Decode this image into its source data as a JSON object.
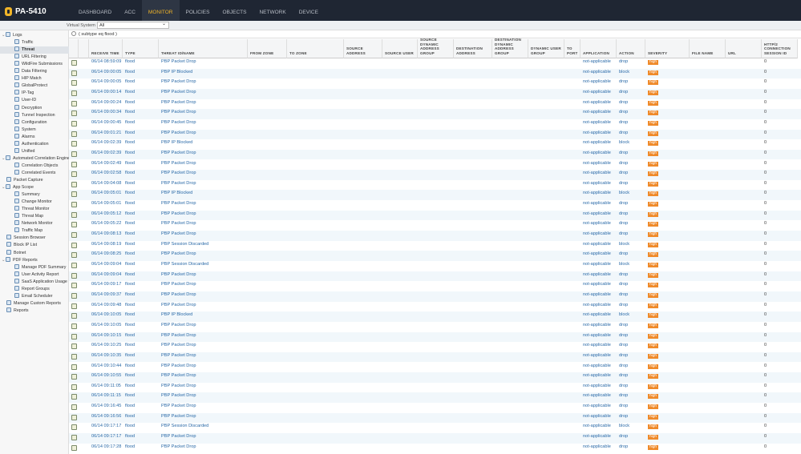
{
  "app": {
    "title": "PA-5410"
  },
  "nav": {
    "tabs": [
      {
        "label": "DASHBOARD"
      },
      {
        "label": "ACC"
      },
      {
        "label": "MONITOR",
        "active": true
      },
      {
        "label": "POLICIES"
      },
      {
        "label": "OBJECTS"
      },
      {
        "label": "NETWORK"
      },
      {
        "label": "DEVICE"
      }
    ]
  },
  "vsys": {
    "label": "Virtual System",
    "value": "All"
  },
  "search": {
    "query": "( subtype eq flood )"
  },
  "sidebar": [
    {
      "label": "Logs",
      "level": 0,
      "expander": true,
      "icon": "logs-icon"
    },
    {
      "label": "Traffic",
      "level": 1,
      "icon": "traffic-icon"
    },
    {
      "label": "Threat",
      "level": 1,
      "icon": "threat-icon",
      "active": true
    },
    {
      "label": "URL Filtering",
      "level": 1,
      "icon": "url-filtering-icon"
    },
    {
      "label": "WildFire Submissions",
      "level": 1,
      "icon": "wildfire-icon"
    },
    {
      "label": "Data Filtering",
      "level": 1,
      "icon": "data-filtering-icon"
    },
    {
      "label": "HIP Match",
      "level": 1,
      "icon": "hip-match-icon"
    },
    {
      "label": "GlobalProtect",
      "level": 1,
      "icon": "globalprotect-icon"
    },
    {
      "label": "IP-Tag",
      "level": 1,
      "icon": "ip-tag-icon"
    },
    {
      "label": "User-ID",
      "level": 1,
      "icon": "user-id-icon"
    },
    {
      "label": "Decryption",
      "level": 1,
      "icon": "decryption-icon"
    },
    {
      "label": "Tunnel Inspection",
      "level": 1,
      "icon": "tunnel-icon"
    },
    {
      "label": "Configuration",
      "level": 1,
      "icon": "configuration-icon"
    },
    {
      "label": "System",
      "level": 1,
      "icon": "system-icon"
    },
    {
      "label": "Alarms",
      "level": 1,
      "icon": "alarms-icon"
    },
    {
      "label": "Authentication",
      "level": 1,
      "icon": "authentication-icon"
    },
    {
      "label": "Unified",
      "level": 1,
      "icon": "unified-icon"
    },
    {
      "label": "Automated Correlation Engine",
      "level": 0,
      "expander": true,
      "icon": "correlation-engine-icon"
    },
    {
      "label": "Correlation Objects",
      "level": 1,
      "icon": "correlation-objects-icon"
    },
    {
      "label": "Correlated Events",
      "level": 1,
      "icon": "correlated-events-icon"
    },
    {
      "label": "Packet Capture",
      "level": 0,
      "icon": "packet-capture-icon"
    },
    {
      "label": "App Scope",
      "level": 0,
      "expander": true,
      "icon": "app-scope-icon"
    },
    {
      "label": "Summary",
      "level": 1,
      "icon": "summary-icon"
    },
    {
      "label": "Change Monitor",
      "level": 1,
      "icon": "change-monitor-icon"
    },
    {
      "label": "Threat Monitor",
      "level": 1,
      "icon": "threat-monitor-icon"
    },
    {
      "label": "Threat Map",
      "level": 1,
      "icon": "threat-map-icon"
    },
    {
      "label": "Network Monitor",
      "level": 1,
      "icon": "network-monitor-icon"
    },
    {
      "label": "Traffic Map",
      "level": 1,
      "icon": "traffic-map-icon"
    },
    {
      "label": "Session Browser",
      "level": 0,
      "icon": "session-browser-icon"
    },
    {
      "label": "Block IP List",
      "level": 0,
      "icon": "block-ip-icon"
    },
    {
      "label": "Botnet",
      "level": 0,
      "icon": "botnet-icon"
    },
    {
      "label": "PDF Reports",
      "level": 0,
      "expander": true,
      "icon": "pdf-reports-icon"
    },
    {
      "label": "Manage PDF Summary",
      "level": 1,
      "icon": "pdf-summary-icon"
    },
    {
      "label": "User Activity Report",
      "level": 1,
      "icon": "user-activity-icon"
    },
    {
      "label": "SaaS Application Usage",
      "level": 1,
      "icon": "saas-icon"
    },
    {
      "label": "Report Groups",
      "level": 1,
      "icon": "report-groups-icon"
    },
    {
      "label": "Email Scheduler",
      "level": 1,
      "icon": "email-scheduler-icon"
    },
    {
      "label": "Manage Custom Reports",
      "level": 0,
      "icon": "custom-reports-icon"
    },
    {
      "label": "Reports",
      "level": 0,
      "icon": "reports-icon"
    }
  ],
  "columns": [
    {
      "key": "receive_time",
      "label": "RECEIVE TIME"
    },
    {
      "key": "type",
      "label": "TYPE"
    },
    {
      "key": "threat",
      "label": "THREAT ID/NAME"
    },
    {
      "key": "from_zone",
      "label": "FROM ZONE"
    },
    {
      "key": "to_zone",
      "label": "TO ZONE"
    },
    {
      "key": "src_addr",
      "label": "SOURCE ADDRESS"
    },
    {
      "key": "src_user",
      "label": "SOURCE USER"
    },
    {
      "key": "src_dag",
      "label": "SOURCE DYNAMIC ADDRESS GROUP"
    },
    {
      "key": "dst_addr",
      "label": "DESTINATION ADDRESS"
    },
    {
      "key": "dst_dag",
      "label": "DESTINATION DYNAMIC ADDRESS GROUP"
    },
    {
      "key": "dug",
      "label": "DYNAMIC USER GROUP"
    },
    {
      "key": "to_port",
      "label": "TO PORT"
    },
    {
      "key": "application",
      "label": "APPLICATION"
    },
    {
      "key": "action",
      "label": "ACTION"
    },
    {
      "key": "severity",
      "label": "SEVERITY"
    },
    {
      "key": "file_name",
      "label": "FILE NAME"
    },
    {
      "key": "url",
      "label": "URL"
    },
    {
      "key": "http2",
      "label": "HTTP/2 CONNECTION SESSION ID"
    }
  ],
  "rows": [
    [
      "06/14 08:59:09",
      "PBP Packet Drop",
      "drop"
    ],
    [
      "06/14 09:00:05",
      "PBP IP Blocked",
      "block"
    ],
    [
      "06/14 09:00:05",
      "PBP Packet Drop",
      "drop"
    ],
    [
      "06/14 09:00:14",
      "PBP Packet Drop",
      "drop"
    ],
    [
      "06/14 09:00:24",
      "PBP Packet Drop",
      "drop"
    ],
    [
      "06/14 09:00:34",
      "PBP Packet Drop",
      "drop"
    ],
    [
      "06/14 09:00:45",
      "PBP Packet Drop",
      "drop"
    ],
    [
      "06/14 09:01:21",
      "PBP Packet Drop",
      "drop"
    ],
    [
      "06/14 09:02:39",
      "PBP IP Blocked",
      "block"
    ],
    [
      "06/14 09:02:39",
      "PBP Packet Drop",
      "drop"
    ],
    [
      "06/14 09:02:49",
      "PBP Packet Drop",
      "drop"
    ],
    [
      "06/14 09:02:58",
      "PBP Packet Drop",
      "drop"
    ],
    [
      "06/14 09:04:08",
      "PBP Packet Drop",
      "drop"
    ],
    [
      "06/14 09:05:01",
      "PBP IP Blocked",
      "block"
    ],
    [
      "06/14 09:05:01",
      "PBP Packet Drop",
      "drop"
    ],
    [
      "06/14 09:05:12",
      "PBP Packet Drop",
      "drop"
    ],
    [
      "06/14 09:05:22",
      "PBP Packet Drop",
      "drop"
    ],
    [
      "06/14 09:08:13",
      "PBP Packet Drop",
      "drop"
    ],
    [
      "06/14 09:08:19",
      "PBP Session Discarded",
      "block"
    ],
    [
      "06/14 09:08:25",
      "PBP Packet Drop",
      "drop"
    ],
    [
      "06/14 09:09:04",
      "PBP Session Discarded",
      "block"
    ],
    [
      "06/14 09:09:04",
      "PBP Packet Drop",
      "drop"
    ],
    [
      "06/14 09:09:17",
      "PBP Packet Drop",
      "drop"
    ],
    [
      "06/14 09:09:37",
      "PBP Packet Drop",
      "drop"
    ],
    [
      "06/14 09:09:48",
      "PBP Packet Drop",
      "drop"
    ],
    [
      "06/14 09:10:05",
      "PBP IP Blocked",
      "block"
    ],
    [
      "06/14 09:10:05",
      "PBP Packet Drop",
      "drop"
    ],
    [
      "06/14 09:10:15",
      "PBP Packet Drop",
      "drop"
    ],
    [
      "06/14 09:10:25",
      "PBP Packet Drop",
      "drop"
    ],
    [
      "06/14 09:10:35",
      "PBP Packet Drop",
      "drop"
    ],
    [
      "06/14 09:10:44",
      "PBP Packet Drop",
      "drop"
    ],
    [
      "06/14 09:10:55",
      "PBP Packet Drop",
      "drop"
    ],
    [
      "06/14 09:11:05",
      "PBP Packet Drop",
      "drop"
    ],
    [
      "06/14 09:11:15",
      "PBP Packet Drop",
      "drop"
    ],
    [
      "06/14 09:16:45",
      "PBP Packet Drop",
      "drop"
    ],
    [
      "06/14 09:16:56",
      "PBP Packet Drop",
      "drop"
    ],
    [
      "06/14 09:17:17",
      "PBP Session Discarded",
      "block"
    ],
    [
      "06/14 09:17:17",
      "PBP Packet Drop",
      "drop"
    ],
    [
      "06/14 09:17:28",
      "PBP Packet Drop",
      "drop"
    ]
  ],
  "row_defaults": {
    "type": "flood",
    "application": "not-applicable",
    "severity": "high",
    "http2": "0"
  },
  "colors": {
    "topbar": "#1f2633",
    "accent": "#f0b428",
    "link": "#2a6aa8",
    "severity_high": "#ef8a2a"
  }
}
